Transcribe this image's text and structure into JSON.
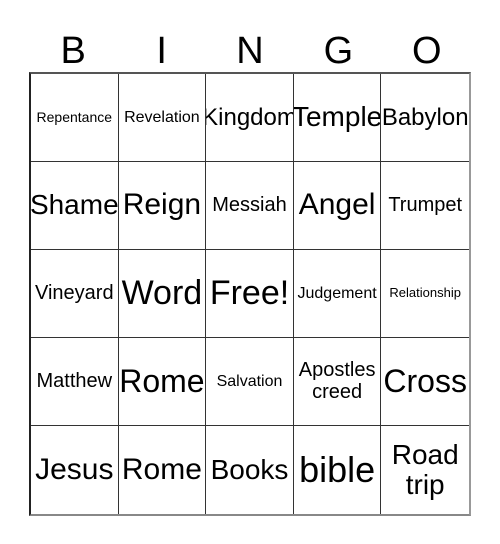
{
  "card": {
    "title": "BINGO",
    "columns": [
      "B",
      "I",
      "N",
      "G",
      "O"
    ],
    "free_space_label": "Free!",
    "free_space_position": {
      "row": 3,
      "column": 3
    },
    "grid_rows": 5,
    "grid_columns": 5,
    "colors": {
      "background": "#ffffff",
      "text": "#000000",
      "border": "#333333"
    }
  },
  "header": {
    "letters": [
      {
        "label": "B"
      },
      {
        "label": "I"
      },
      {
        "label": "N"
      },
      {
        "label": "G"
      },
      {
        "label": "O"
      }
    ]
  },
  "cells": [
    {
      "label": "Repentance",
      "size": "fs-sm"
    },
    {
      "label": "Revelation",
      "size": "fs-md"
    },
    {
      "label": "Kingdom",
      "size": "fs-xl"
    },
    {
      "label": "Temple",
      "size": "fs-2xl"
    },
    {
      "label": "Babylon",
      "size": "fs-xl"
    },
    {
      "label": "Shame",
      "size": "fs-2xl"
    },
    {
      "label": "Reign",
      "size": "fs-3xl"
    },
    {
      "label": "Messiah",
      "size": "fs-lg"
    },
    {
      "label": "Angel",
      "size": "fs-3xl"
    },
    {
      "label": "Trumpet",
      "size": "fs-lg"
    },
    {
      "label": "Vineyard",
      "size": "fs-lg"
    },
    {
      "label": "Word",
      "size": "fs-5xl"
    },
    {
      "label": "Free!",
      "size": "fs-5xl"
    },
    {
      "label": "Judgement",
      "size": "fs-md"
    },
    {
      "label": "Relationship",
      "size": "fs-xs"
    },
    {
      "label": "Matthew",
      "size": "fs-lg"
    },
    {
      "label": "Rome",
      "size": "fs-4xl"
    },
    {
      "label": "Salvation",
      "size": "fs-md"
    },
    {
      "label": "Apostles\ncreed",
      "size": "fs-lg"
    },
    {
      "label": "Cross",
      "size": "fs-4xl"
    },
    {
      "label": "Jesus",
      "size": "fs-3xl"
    },
    {
      "label": "Rome",
      "size": "fs-3xl"
    },
    {
      "label": "Books",
      "size": "fs-2xl"
    },
    {
      "label": "bible",
      "size": "fs-6xl"
    },
    {
      "label": "Road\ntrip",
      "size": "fs-2xl"
    }
  ]
}
